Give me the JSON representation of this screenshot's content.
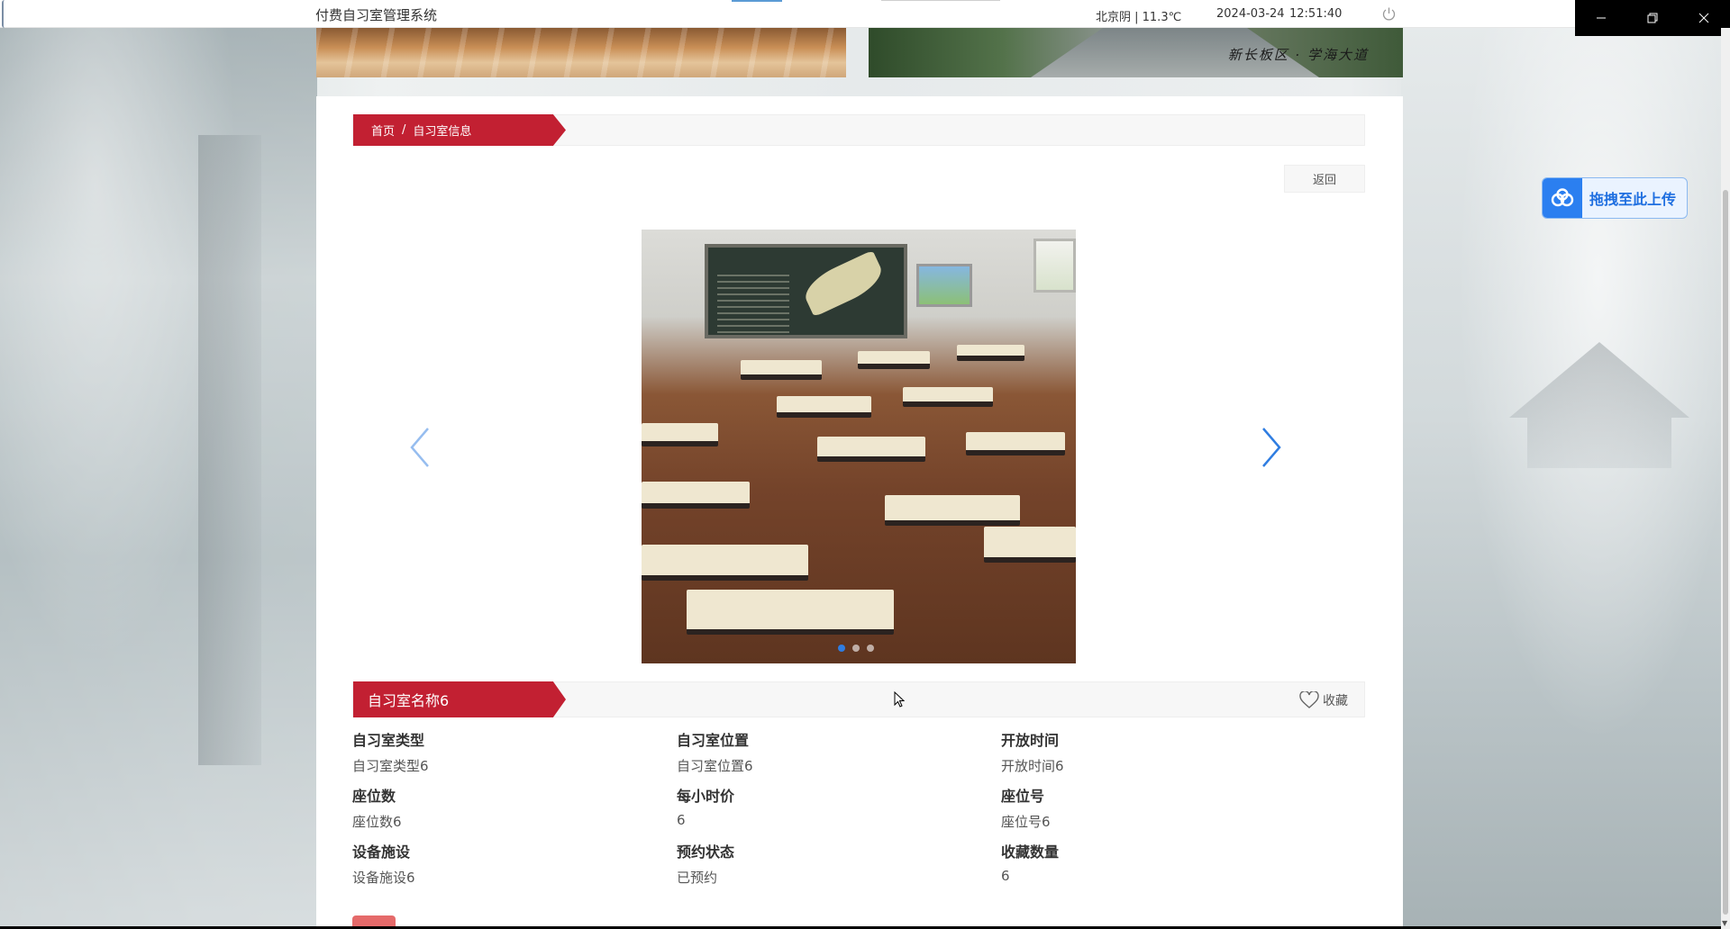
{
  "app": {
    "title": "付费自习室管理系统",
    "weather": "北京阴 | 11.3℃",
    "date": "2024-03-24",
    "time": "12:51:40"
  },
  "banner": {
    "caption": "新长板区 · 学海大道"
  },
  "breadcrumb": {
    "home": "首页",
    "separator": "/",
    "current": "自习室信息"
  },
  "actions": {
    "back": "返回",
    "favorite": "收藏"
  },
  "carousel": {
    "slide_count": 3,
    "active_index": 0
  },
  "room": {
    "name": "自习室名称6",
    "fields": [
      {
        "label": "自习室类型",
        "value": "自习室类型6"
      },
      {
        "label": "自习室位置",
        "value": "自习室位置6"
      },
      {
        "label": "开放时间",
        "value": "开放时间6"
      },
      {
        "label": "座位数",
        "value": "座位数6"
      },
      {
        "label": "每小时价",
        "value": "6"
      },
      {
        "label": "座位号",
        "value": "座位号6"
      },
      {
        "label": "设备施设",
        "value": "设备施设6"
      },
      {
        "label": "预约状态",
        "value": "已预约"
      },
      {
        "label": "收藏数量",
        "value": "6"
      }
    ]
  },
  "upload_widget": {
    "label": "拖拽至此上传"
  },
  "colors": {
    "primary_red": "#c22032",
    "accent_blue": "#2f7de1"
  }
}
